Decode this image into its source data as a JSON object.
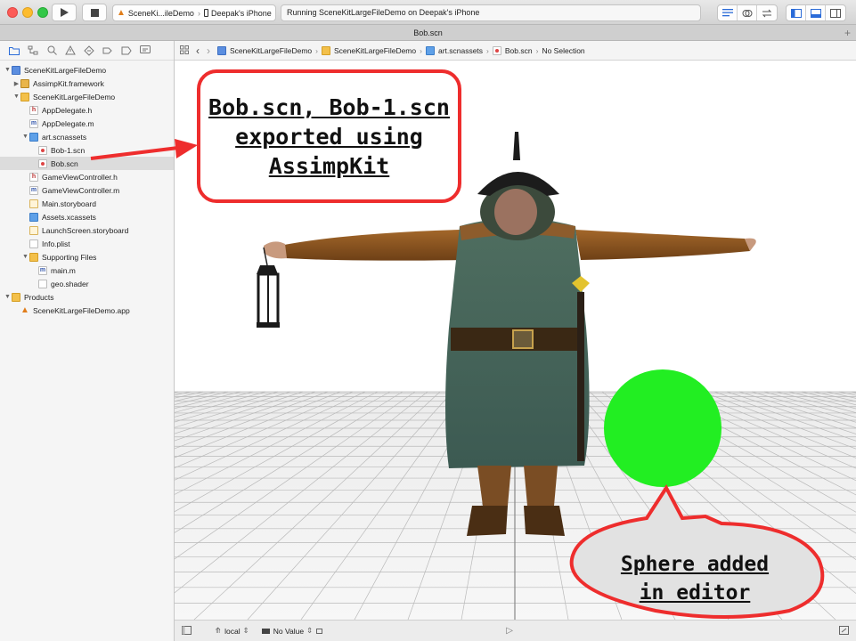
{
  "toolbar": {
    "scheme_name": "SceneKi...ileDemo",
    "device_name": "Deepak's iPhone",
    "activity_status": "Running SceneKitLargeFileDemo on Deepak's iPhone",
    "play_icon": "play-icon",
    "stop_icon": "stop-icon"
  },
  "tab": {
    "title": "Bob.scn",
    "add_icon": "plus-icon"
  },
  "navigator": {
    "items": [
      {
        "label": "SceneKitLargeFileDemo",
        "icon": "project-icon",
        "indent": 0,
        "disclosure": "open"
      },
      {
        "label": "AssimpKit.framework",
        "icon": "framework-icon",
        "indent": 1,
        "disclosure": "closed"
      },
      {
        "label": "SceneKitLargeFileDemo",
        "icon": "folder-icon",
        "indent": 1,
        "disclosure": "open"
      },
      {
        "label": "AppDelegate.h",
        "icon": "header-file-icon",
        "indent": 2,
        "disclosure": ""
      },
      {
        "label": "AppDelegate.m",
        "icon": "source-file-icon",
        "indent": 2,
        "disclosure": ""
      },
      {
        "label": "art.scnassets",
        "icon": "asset-folder-icon",
        "indent": 2,
        "disclosure": "open"
      },
      {
        "label": "Bob-1.scn",
        "icon": "scene-file-icon",
        "indent": 3,
        "disclosure": ""
      },
      {
        "label": "Bob.scn",
        "icon": "scene-file-icon",
        "indent": 3,
        "disclosure": "",
        "selected": true
      },
      {
        "label": "GameViewController.h",
        "icon": "header-file-icon",
        "indent": 2,
        "disclosure": ""
      },
      {
        "label": "GameViewController.m",
        "icon": "source-file-icon",
        "indent": 2,
        "disclosure": ""
      },
      {
        "label": "Main.storyboard",
        "icon": "storyboard-icon",
        "indent": 2,
        "disclosure": ""
      },
      {
        "label": "Assets.xcassets",
        "icon": "asset-catalog-icon",
        "indent": 2,
        "disclosure": ""
      },
      {
        "label": "LaunchScreen.storyboard",
        "icon": "storyboard-icon",
        "indent": 2,
        "disclosure": ""
      },
      {
        "label": "Info.plist",
        "icon": "plist-icon",
        "indent": 2,
        "disclosure": ""
      },
      {
        "label": "Supporting Files",
        "icon": "folder-icon",
        "indent": 2,
        "disclosure": "open"
      },
      {
        "label": "main.m",
        "icon": "source-file-icon",
        "indent": 3,
        "disclosure": ""
      },
      {
        "label": "geo.shader",
        "icon": "file-icon",
        "indent": 3,
        "disclosure": ""
      },
      {
        "label": "Products",
        "icon": "folder-icon",
        "indent": 0,
        "disclosure": "open"
      },
      {
        "label": "SceneKitLargeFileDemo.app",
        "icon": "app-icon",
        "indent": 1,
        "disclosure": ""
      }
    ]
  },
  "jumpbar": {
    "crumbs": [
      "SceneKitLargeFileDemo",
      "SceneKitLargeFileDemo",
      "art.scnassets",
      "Bob.scn",
      "No Selection"
    ]
  },
  "bottombar": {
    "coordinate_space": "local",
    "camera": "No Value"
  },
  "annotations": {
    "callout_lines": [
      "Bob.scn, Bob-1.scn",
      "exported using",
      "AssimpKit"
    ],
    "bubble_lines": [
      "Sphere added",
      "in editor"
    ],
    "sphere_color": "#22ee22",
    "annotation_color": "#ee2d2d"
  }
}
